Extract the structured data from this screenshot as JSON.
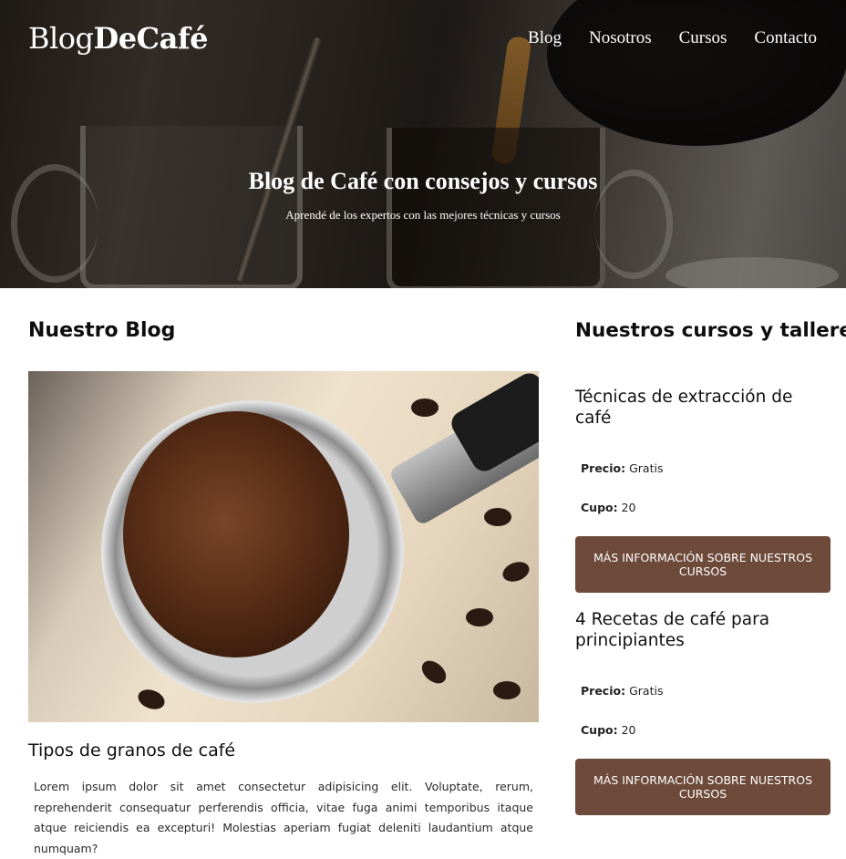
{
  "header": {
    "logo_prefix": "Blog",
    "logo_bold": "DeCafé",
    "nav": [
      "Blog",
      "Nosotros",
      "Cursos",
      "Contacto"
    ]
  },
  "hero": {
    "title": "Blog de Café con consejos y cursos",
    "subtitle": "Aprendé de los expertos con las mejores técnicas y cursos"
  },
  "blog": {
    "section_title": "Nuestro Blog",
    "post": {
      "title": "Tipos de granos de café",
      "body": "Lorem ipsum dolor sit amet consectetur adipisicing elit. Voluptate, rerum, reprehenderit consequatur perferendis officia, vitae fuga animi temporibus itaque atque reiciendis ea excepturi! Molestias aperiam fugiat deleniti laudantium atque numquam?"
    }
  },
  "courses": {
    "section_title": "Nuestros cursos y talleres",
    "items": [
      {
        "title": "Técnicas de extracción de café",
        "price_label": "Precio:",
        "price": "Gratis",
        "quota_label": "Cupo:",
        "quota": "20",
        "button": "Más información sobre nuestros cursos"
      },
      {
        "title": "4 Recetas de café para principiantes",
        "price_label": "Precio:",
        "price": "Gratis",
        "quota_label": "Cupo:",
        "quota": "20",
        "button": "Más información sobre nuestros cursos"
      }
    ]
  },
  "colors": {
    "accent": "#6e4a3a"
  }
}
